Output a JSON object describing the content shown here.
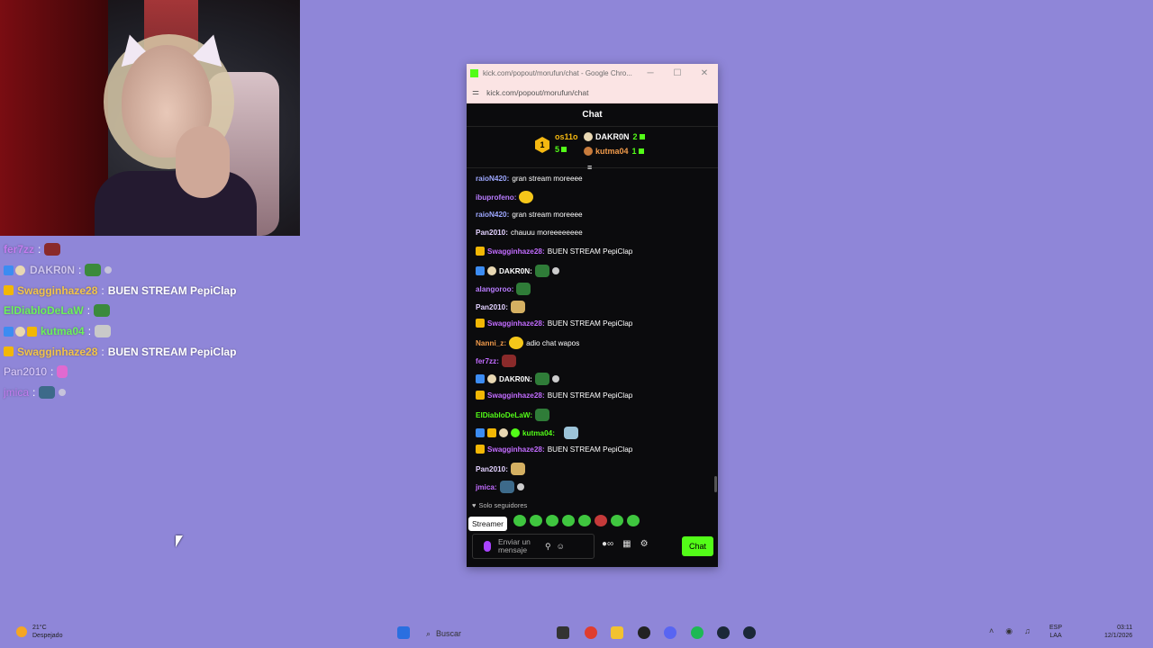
{
  "overlay_chat": [
    {
      "user": "fer7zz",
      "color": "#c47cf0",
      "sep": ":",
      "text": "",
      "emote": "gift"
    },
    {
      "user": "DAKR0N",
      "color": "#cfc6ee",
      "sep": ":",
      "text": "",
      "emote": "pepe"
    },
    {
      "user": "Swagginhaze28",
      "color": "#f2c44a",
      "sep": ":",
      "text": "BUEN STREAM PepiClap",
      "emote": ""
    },
    {
      "user": "ElDiabloDeLaW",
      "color": "#6df35a",
      "sep": ":",
      "text": "",
      "emote": "pepe"
    },
    {
      "user": "kutma04",
      "color": "#6df35a",
      "sep": ":",
      "text": "",
      "emote": "pepe"
    },
    {
      "user": "Swagginhaze28",
      "color": "#f2c44a",
      "sep": ":",
      "text": "BUEN STREAM PepiClap",
      "emote": ""
    },
    {
      "user": "Pan2010",
      "color": "#e2d1ff",
      "sep": ":",
      "text": "",
      "emote": "bird"
    },
    {
      "user": "jmica",
      "color": "#c47cf0",
      "sep": ":",
      "text": "",
      "emote": "pepe"
    }
  ],
  "window": {
    "title": "kick.com/popout/morufun/chat - Google Chro...",
    "url": "kick.com/popout/morufun/chat"
  },
  "chat": {
    "header": "Chat",
    "leaderboard": {
      "first": {
        "rank": "1",
        "name": "os11o",
        "count": "5"
      },
      "second": {
        "name": "DAKR0N",
        "count": "2"
      },
      "third": {
        "name": "kutma04",
        "count": "1"
      }
    },
    "messages": [
      {
        "user": "raioN420:",
        "color": "#9da7ff",
        "text": "gran stream moreeee"
      },
      {
        "user": "ibuprofeno:",
        "color": "#b97cff",
        "text": ""
      },
      {
        "user": "raioN420:",
        "color": "#9da7ff",
        "text": "gran stream moreeee"
      },
      {
        "user": "Pan2010:",
        "color": "#e2d1ff",
        "text": "chauuu moreeeeeeee"
      },
      {
        "user": "Swagginhaze28:",
        "color": "#c26cff",
        "text": "BUEN STREAM PepiClap"
      },
      {
        "user": "DAKR0N:",
        "color": "#ffffff",
        "text": ""
      },
      {
        "user": "alangoroo:",
        "color": "#b97cff",
        "text": ""
      },
      {
        "user": "Pan2010:",
        "color": "#e2d1ff",
        "text": ""
      },
      {
        "user": "Swagginhaze28:",
        "color": "#c26cff",
        "text": "BUEN STREAM PepiClap"
      },
      {
        "user": "Nanni_z:",
        "color": "#f29b4b",
        "text": "adio chat wapos"
      },
      {
        "user": "fer7zz:",
        "color": "#c26cff",
        "text": ""
      },
      {
        "user": "DAKR0N:",
        "color": "#ffffff",
        "text": ""
      },
      {
        "user": "Swagginhaze28:",
        "color": "#c26cff",
        "text": "BUEN STREAM PepiClap"
      },
      {
        "user": "ElDiabloDeLaW:",
        "color": "#53fc18",
        "text": ""
      },
      {
        "user": "kutma04:",
        "color": "#53fc18",
        "text": ""
      },
      {
        "user": "Swagginhaze28:",
        "color": "#c26cff",
        "text": "BUEN STREAM PepiClap"
      },
      {
        "user": "Pan2010:",
        "color": "#e2d1ff",
        "text": ""
      },
      {
        "user": "jmica:",
        "color": "#c26cff",
        "text": ""
      }
    ],
    "followers_only": "Solo seguidores",
    "tooltip": "Streamer",
    "input_placeholder": "Enviar un mensaje",
    "send_label": "Chat"
  },
  "taskbar": {
    "weather_temp": "21°C",
    "weather_desc": "Despejado",
    "search_label": "Buscar",
    "lang_line1": "ESP",
    "lang_line2": "LAA",
    "time": "03:11",
    "date": "12/1/2026"
  },
  "colors": {
    "desktop": "#8f86d8",
    "kick_green": "#53fc18",
    "chat_bg": "#0b0b0d"
  }
}
